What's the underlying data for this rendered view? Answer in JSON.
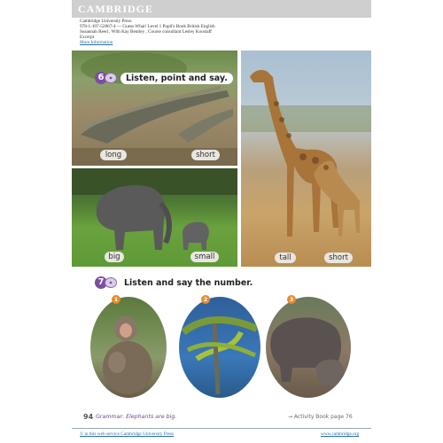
{
  "header": {
    "brand": "CAMBRIDGE",
    "publisher": "Cambridge University Press",
    "isbn_line": "978-1-107-52867-4 — Guess What! Level 1 Pupil's Book British English",
    "authors_line": "Susannah Reed , With Kay Bentley , Course consultant Lesley Koustaff",
    "excerpt": "Excerpt",
    "more_info": "More Information"
  },
  "activity6": {
    "number": "6",
    "instruction": "Listen, point and say.",
    "words": {
      "long": "long",
      "short1": "short",
      "big": "big",
      "small": "small",
      "tall": "tall",
      "short2": "short"
    }
  },
  "activity7": {
    "number": "7",
    "instruction": "Listen and say the number.",
    "badges": [
      "1",
      "2",
      "3"
    ]
  },
  "footer": {
    "page_number": "94",
    "grammar_label": "Grammar:",
    "grammar_text": "Elephants are big.",
    "activity_book": "→ Activity Book page 76",
    "left_link": "© in this web service Cambridge University Press",
    "right_link": "www.cambridge.org"
  },
  "colors": {
    "activity_accent": "#7b4fa0",
    "badge_orange": "#e88a2a",
    "link_blue": "#2a6db0",
    "header_gray": "#cfcfcf"
  }
}
